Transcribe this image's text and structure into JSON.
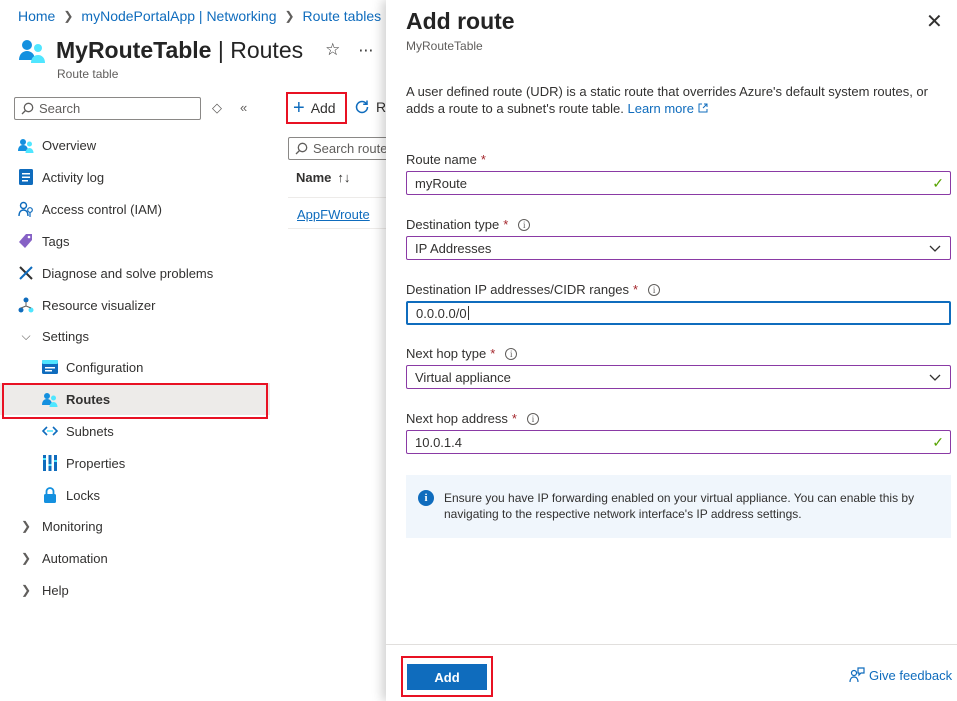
{
  "breadcrumb": {
    "items": [
      "Home",
      "myNodePortalApp | Networking",
      "Route tables"
    ]
  },
  "header": {
    "title_bold": "MyRouteTable",
    "title_rest": " | Routes",
    "subtitle": "Route table"
  },
  "sidebar": {
    "search_placeholder": "Search",
    "items": [
      {
        "label": "Overview",
        "icon": "overview-icon"
      },
      {
        "label": "Activity log",
        "icon": "activity-log-icon"
      },
      {
        "label": "Access control (IAM)",
        "icon": "iam-icon"
      },
      {
        "label": "Tags",
        "icon": "tag-icon"
      },
      {
        "label": "Diagnose and solve problems",
        "icon": "wrench-icon"
      },
      {
        "label": "Resource visualizer",
        "icon": "visualizer-icon"
      }
    ],
    "settings": {
      "label": "Settings",
      "children": [
        {
          "label": "Configuration",
          "icon": "configuration-icon"
        },
        {
          "label": "Routes",
          "icon": "routes-icon"
        },
        {
          "label": "Subnets",
          "icon": "subnets-icon"
        },
        {
          "label": "Properties",
          "icon": "properties-icon"
        },
        {
          "label": "Locks",
          "icon": "lock-icon"
        }
      ]
    },
    "groups": [
      "Monitoring",
      "Automation",
      "Help"
    ]
  },
  "main": {
    "add_label": "Add",
    "refresh_label": "R",
    "filter_placeholder": "Search route",
    "column_name": "Name",
    "sort_glyph": "↑↓",
    "rows": [
      "AppFWroute"
    ]
  },
  "panel": {
    "title": "Add route",
    "subtitle": "MyRouteTable",
    "description": "A user defined route (UDR) is a static route that overrides Azure's default system routes, or adds a route to a subnet's route table.",
    "learn_more": "Learn more",
    "fields": {
      "route_name": {
        "label": "Route name",
        "value": "myRoute"
      },
      "destination_type": {
        "label": "Destination type",
        "value": "IP Addresses"
      },
      "destination_ip": {
        "label": "Destination IP addresses/CIDR ranges",
        "value": "0.0.0.0/0"
      },
      "next_hop_type": {
        "label": "Next hop type",
        "value": "Virtual appliance"
      },
      "next_hop_address": {
        "label": "Next hop address",
        "value": "10.0.1.4"
      }
    },
    "required_mark": "*",
    "info_mark": "i",
    "info_text": "Ensure you have IP forwarding enabled on your virtual appliance. You can enable this by navigating to the respective network interface's IP address settings.",
    "add_button": "Add",
    "feedback": "Give feedback"
  },
  "colors": {
    "accent": "#0f6cbd",
    "highlight": "#e81123",
    "valid": "#57a300",
    "required": "#a4262c"
  }
}
